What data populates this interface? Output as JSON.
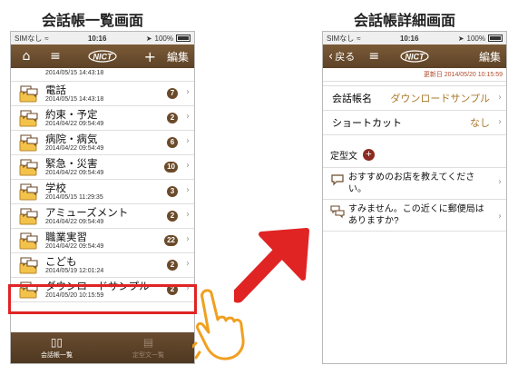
{
  "captions": {
    "left": "会話帳一覧画面",
    "right": "会話帳詳細画面"
  },
  "status_bar": {
    "carrier": "SIMなし",
    "time": "10:16",
    "battery": "100%"
  },
  "list_screen": {
    "nav": {
      "edit_label": "編集",
      "add_label": "+"
    },
    "partial_badge": "",
    "rows": [
      {
        "title": "",
        "date": "2014/05/15 14:43:18",
        "count": ""
      },
      {
        "title": "電話",
        "date": "2014/05/15 14:43:18",
        "count": "7"
      },
      {
        "title": "約束・予定",
        "date": "2014/04/22 09:54:49",
        "count": "2"
      },
      {
        "title": "病院・病気",
        "date": "2014/04/22 09:54:49",
        "count": "6"
      },
      {
        "title": "緊急・災害",
        "date": "2014/04/22 09:54:49",
        "count": "10"
      },
      {
        "title": "学校",
        "date": "2014/05/15 11:29:35",
        "count": "3"
      },
      {
        "title": "アミューズメント",
        "date": "2014/04/22 09:54:49",
        "count": "2"
      },
      {
        "title": "職業実習",
        "date": "2014/04/22 09:54:49",
        "count": "22"
      },
      {
        "title": "こども",
        "date": "2014/05/19 12:01:24",
        "count": "2"
      },
      {
        "title": "ダウンロードサンプル",
        "date": "2014/05/20 10:15:59",
        "count": "2"
      }
    ],
    "tabs": [
      {
        "label": "会話帳一覧"
      },
      {
        "label": "定型文一覧"
      }
    ]
  },
  "detail_screen": {
    "nav": {
      "back_label": "戻る",
      "edit_label": "編集"
    },
    "updated": "更新日 2014/05/20 10:15:59",
    "name_label": "会話帳名",
    "name_value": "ダウンロードサンプル",
    "shortcut_label": "ショートカット",
    "shortcut_value": "なし",
    "phrases_label": "定型文",
    "phrases": [
      {
        "text": "おすすめのお店を教えてください。"
      },
      {
        "text": "すみません。この近くに郵便局はありますか?"
      }
    ]
  },
  "colors": {
    "brand_brown": "#6b4a2a",
    "accent_red": "#e02424",
    "accent_gold": "#a8782a"
  }
}
